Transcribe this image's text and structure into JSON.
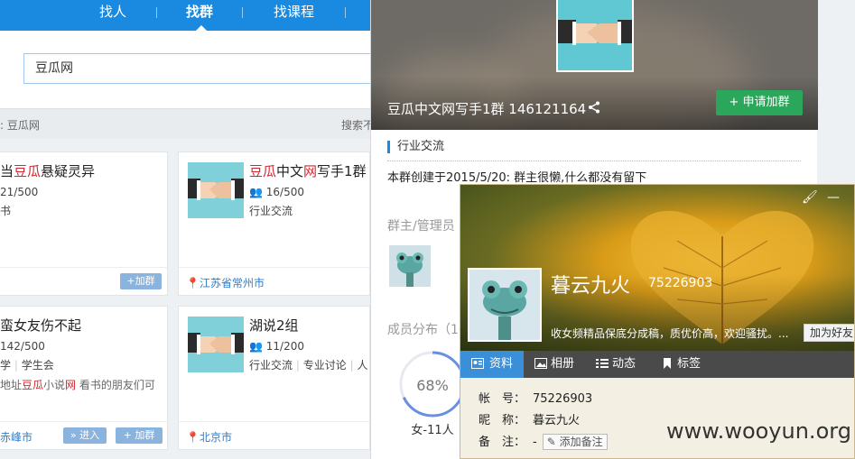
{
  "nav": {
    "items": [
      "找人",
      "找群",
      "找课程"
    ],
    "active_index": 1
  },
  "search": {
    "value": "豆瓜网"
  },
  "result_bar": {
    "left": ": 豆瓜网",
    "right": "搜索不"
  },
  "cards": [
    {
      "title_parts": [
        "当",
        "豆瓜",
        "悬疑灵异"
      ],
      "members": "21/500",
      "category": "书",
      "button": "+加群"
    },
    {
      "title_parts": [
        "",
        "豆瓜",
        "中文",
        "网",
        "写手1群"
      ],
      "members": "16/500",
      "category": "行业交流",
      "location": "江苏省常州市"
    },
    {
      "title": "蛮女友伤不起",
      "members": "142/500",
      "tags": [
        "学",
        "学生会"
      ],
      "desc_parts": [
        "地址",
        "豆瓜",
        "小说",
        "网",
        " 看书的朋友们可"
      ],
      "location": "赤峰市",
      "enter_button": "» 进入",
      "join_button": "+ 加群"
    },
    {
      "title": "湖说2组",
      "members": "11/200",
      "tags": [
        "行业交流",
        "专业讨论",
        "人"
      ],
      "location": "北京市"
    }
  ],
  "group_panel": {
    "name": "豆瓜中文网写手1群 146121164",
    "join_button": "+ 申请加群",
    "tag": "行业交流",
    "created": "本群创建于2015/5/20:  群主很懒,什么都没有留下",
    "admins_label": "群主/管理员",
    "members_label": "成员分布（10",
    "female_pct": 68,
    "pct_label": "68%",
    "gender_label": "女-11人"
  },
  "profile": {
    "nickname": "暮云九火",
    "qq": "75226903",
    "signature": "收女频精品保底分成稿，质优价高，欢迎骚扰。...",
    "add_friend": "加为好友",
    "tabs": [
      "资料",
      "相册",
      "动态",
      "标签"
    ],
    "info": [
      {
        "key": "帐　号：",
        "value": "75226903"
      },
      {
        "key": "昵　称：",
        "value": "暮云九火"
      },
      {
        "key": "备　注：",
        "value": "-"
      }
    ],
    "note_button": "添加备注",
    "window_controls": [
      "brush-icon",
      "minimize-icon"
    ]
  },
  "watermark": "www.wooyun.org",
  "colors": {
    "nav_blue": "#1a8ae0",
    "highlight": "#d0262f",
    "join_green": "#2aa75a",
    "tab_active": "#3b8fd9"
  }
}
